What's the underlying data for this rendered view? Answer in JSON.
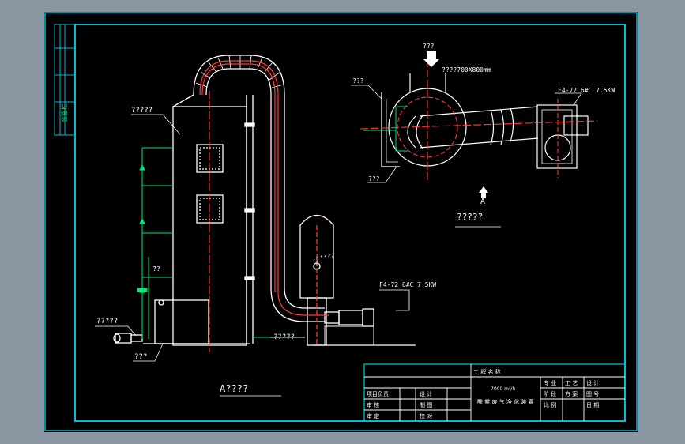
{
  "side_strip": {
    "label": "会签栏"
  },
  "front_view": {
    "caption": "A????",
    "labels": {
      "tower": "?????",
      "pump_label": "??",
      "tank_left": "?????",
      "base": "???",
      "bottom_pipe": "?????",
      "fan_body": "????",
      "fan_model": "F4-72 6#C 7.5KW"
    }
  },
  "plan_view": {
    "caption": "?????",
    "labels": {
      "inlet_top": "???",
      "inlet_size": "????700X800mm",
      "left_top": "???",
      "left_bottom": "???",
      "fan_model": "F4-72 6#C 7.5KW",
      "view_letter": "A"
    }
  },
  "title_block": {
    "project_name_label": "工 程 名 称",
    "capacity": "7000 m³/h",
    "drawing_title": "酸 雾 废 气 净 化 装 置",
    "specialty": "专 业",
    "specialty_value": "工 艺",
    "design_stage_label": "设 计",
    "stage": "阶 段",
    "stage_value": "方 案",
    "scale": "比 例",
    "date": "日 期",
    "rows": [
      {
        "left": "项目负责",
        "mid": "设 计"
      },
      {
        "left": "审  核",
        "mid": "制  图"
      },
      {
        "left": "审  定",
        "mid": "校  对"
      }
    ],
    "right_extra": [
      "图 号",
      "比例"
    ]
  }
}
